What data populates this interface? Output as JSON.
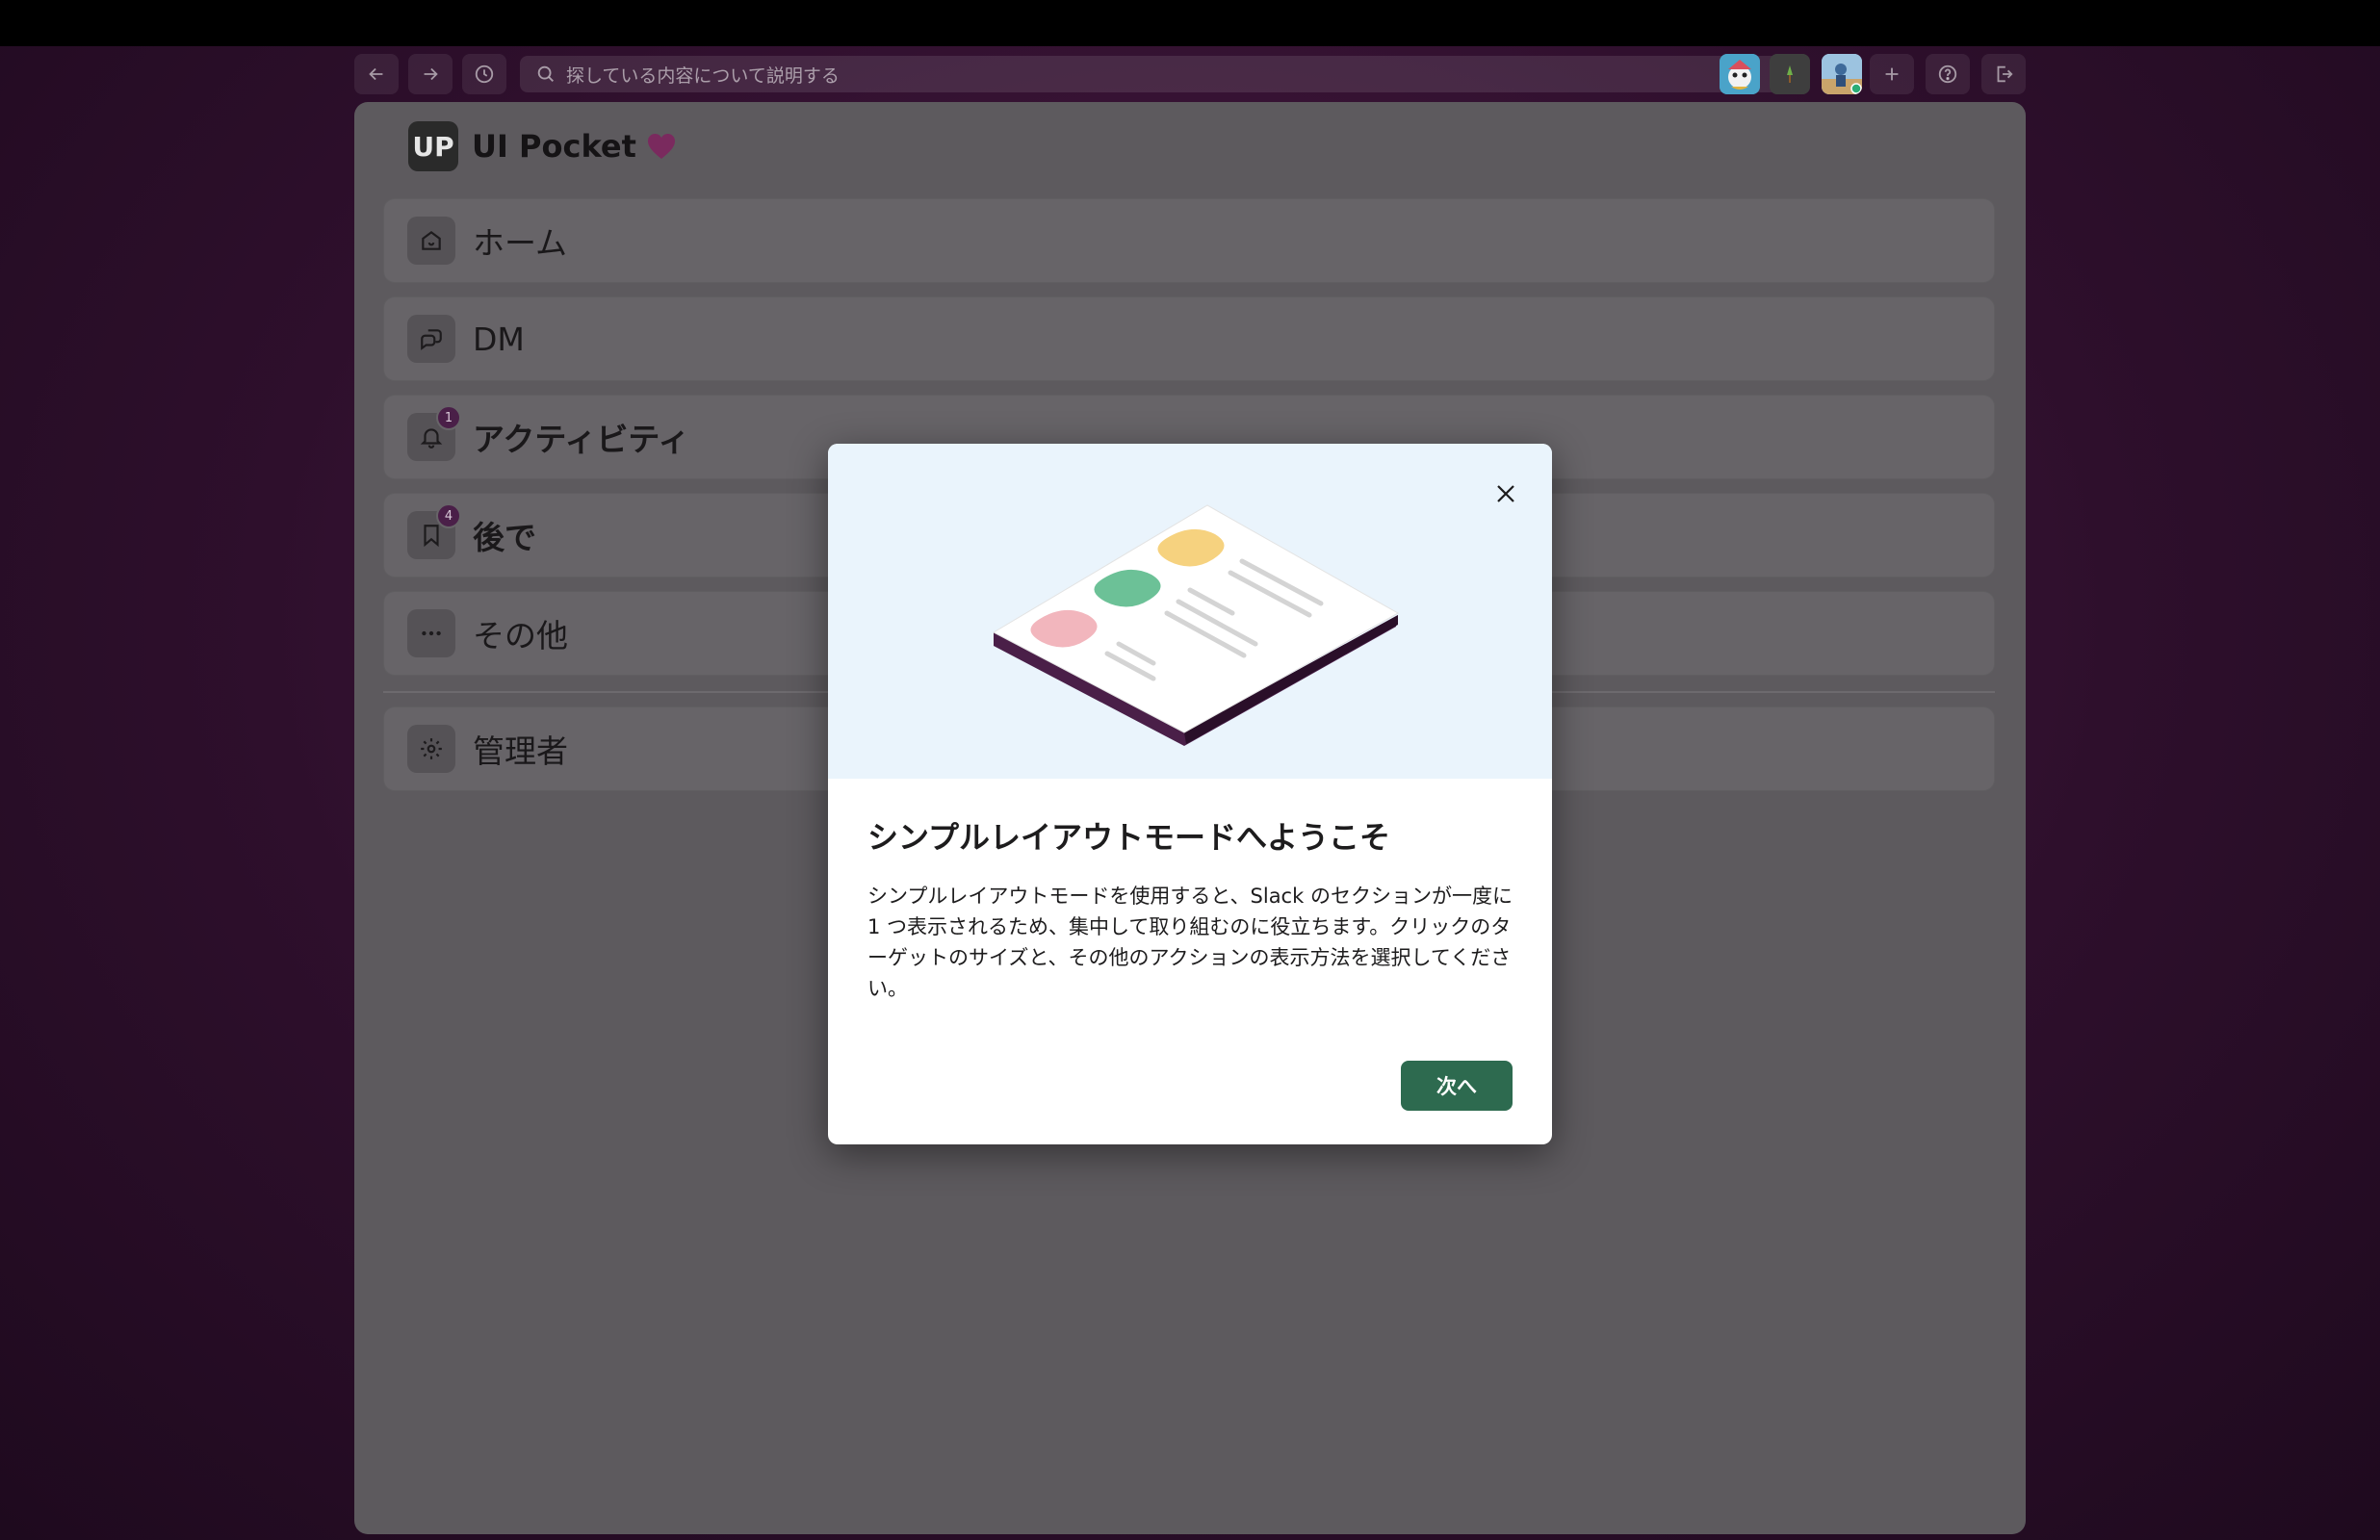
{
  "toolbar": {
    "search_placeholder": "探している内容について説明する",
    "icons": [
      "back-arrow-icon",
      "forward-arrow-icon",
      "history-icon",
      "search-icon",
      "plus-icon",
      "help-icon",
      "logout-icon"
    ]
  },
  "workspace": {
    "logo_text": "UP",
    "name": "UI Pocket"
  },
  "nav": {
    "home": "ホーム",
    "dm": "DM",
    "activity": "アクティビティ",
    "activity_badge": "1",
    "later": "後で",
    "later_badge": "4",
    "more": "その他",
    "admin": "管理者"
  },
  "modal": {
    "title": "シンプルレイアウトモードへようこそ",
    "body": "シンプルレイアウトモードを使用すると、Slack のセクションが一度に 1 つ表示されるため、集中して取り組むのに役立ちます。クリックのターゲットのサイズと、その他のアクションの表示方法を選択してください。",
    "next_button": "次へ"
  },
  "colors": {
    "primary_button": "#2d6a4f",
    "badge": "#4a1f48",
    "background": "#3b1438",
    "modal_hero": "#eaf4fc"
  }
}
